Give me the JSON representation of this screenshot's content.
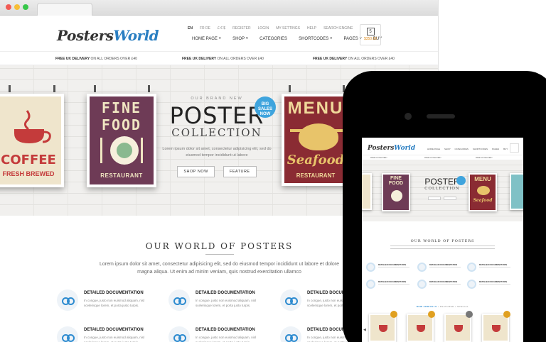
{
  "desktop": {
    "logo": {
      "main": "Posters",
      "accent": "World"
    },
    "topbar": {
      "lang": "EN",
      "lang_alt": "FR  DE",
      "currency": "£  €  $",
      "links": [
        "REGISTER",
        "LOGIN",
        "MY SETTINGS",
        "HELP",
        "SEARCH ENGINE"
      ]
    },
    "nav": [
      "HOME PAGE ˅",
      "SHOP ˅",
      "CATEGORIES",
      "SHORTCODES ˅",
      "PAGES ˅",
      "BUY"
    ],
    "cart": {
      "count": "5",
      "price": "$350.00"
    },
    "delivery": {
      "bold": "FREE UK DELIVERY",
      "rest": " ON ALL ORDERS OVER £40"
    },
    "hero": {
      "brand": "OUR BRAND NEW",
      "headline": "POSTER",
      "subheadline": "COLLECTION",
      "badge": "BIG\nSALES\nNOW",
      "desc": "Lorem ipsum dolor sit amet, consectetur adipisicing elit, sed do eiusmod tempor incididunt ut labore",
      "btn_shop": "SHOP NOW",
      "btn_feature": "FEATURE",
      "posters": {
        "coffee_title": "COFFEE",
        "coffee_sub": "FRESH BREWED",
        "food_title": "FINE FOOD",
        "food_sub": "RESTAURANT",
        "menu_title": "MENU",
        "menu_script": "Seafood",
        "menu_sub": "RESTAURANT"
      }
    },
    "section": {
      "title": "OUR WORLD OF POSTERS",
      "desc": "Lorem ipsum dolor sit amet, consectetur adipisicing elit, sed do eiusmod tempor incididunt ut labore et dolore magna aliqua. Ut enim ad minim veniam, quis nostrud exercitation ullamco",
      "feature_title": "DETAILED DOCUMENTATION",
      "feature_desc": "In congue, justo non euismod aliquam, nisl scelerisque lorem, et porta justo turpis."
    }
  },
  "mobile": {
    "logo": {
      "main": "Posters",
      "accent": "World"
    },
    "nav": [
      "HOME PAGE",
      "SHOP",
      "CATEGORIES",
      "SHORTCODES",
      "PAGES",
      "BUY"
    ],
    "delivery": "FREE UK DELIVERY",
    "hero_headline": "POSTER",
    "hero_subheadline": "COLLECTION",
    "food_title": "FINE FOOD",
    "menu_title": "MENU",
    "menu_script": "Seafood",
    "section_title": "OUR WORLD OF POSTERS",
    "feature_title": "DETAILED DOCUMENTATION",
    "tabs": {
      "active": "NEW ARRIVALS",
      "rest": "  •  FEATURED  •  SPECIAL"
    }
  },
  "colors": {
    "accent": "#2d8bd0",
    "brand_blue": "#2b7fc2",
    "price_orange": "#e08b1b",
    "badge_blue": "#3fa4dd"
  }
}
